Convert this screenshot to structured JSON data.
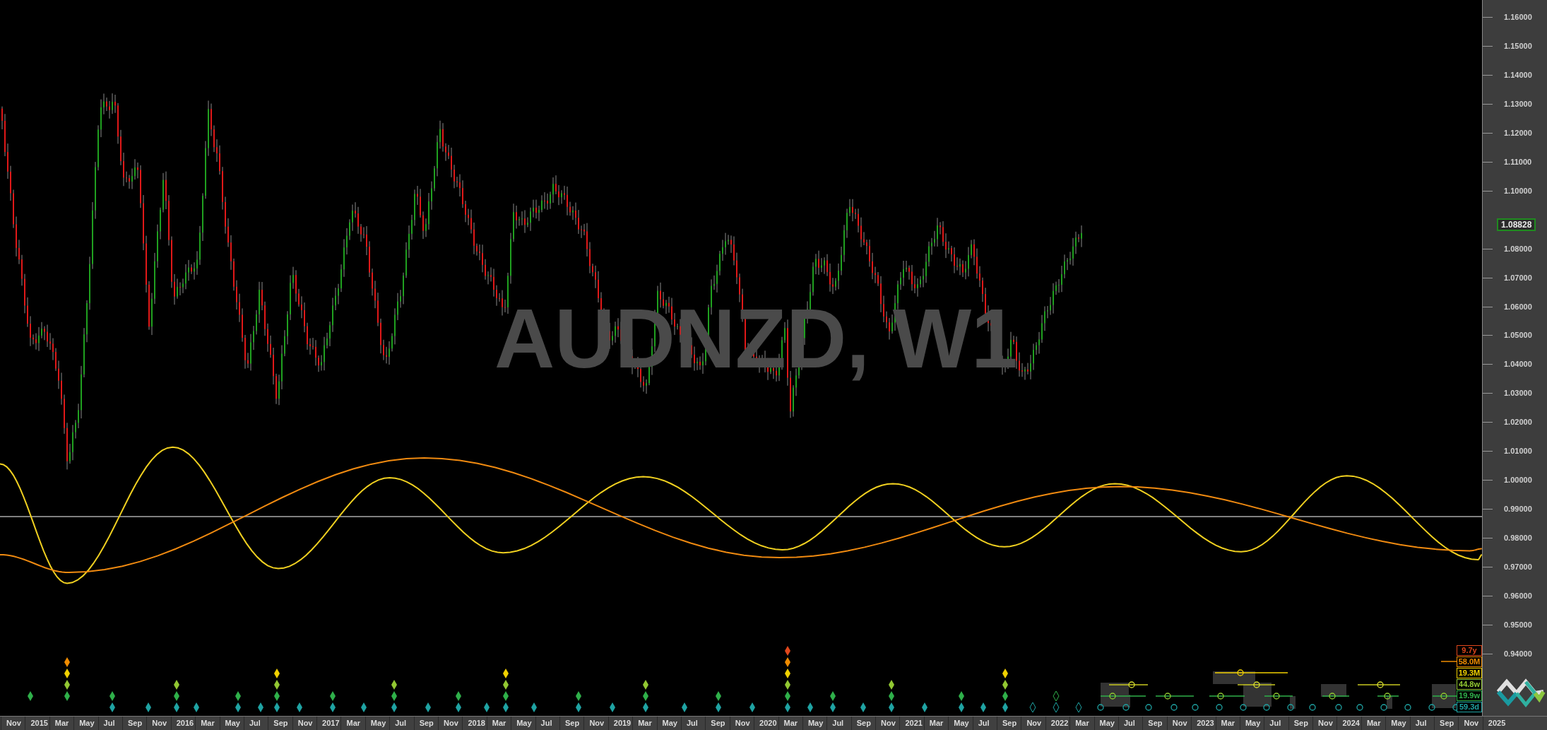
{
  "chart": {
    "symbol_label": "AUDNZD, W1"
  },
  "price_axis": {
    "ticks": [
      "1.16000",
      "1.15000",
      "1.14000",
      "1.13000",
      "1.12000",
      "1.11000",
      "1.10000",
      "1.08000",
      "1.07000",
      "1.06000",
      "1.05000",
      "1.04000",
      "1.03000",
      "1.02000",
      "1.01000",
      "1.00000",
      "0.99000",
      "0.98000",
      "0.97000",
      "0.96000",
      "0.95000",
      "0.94000"
    ],
    "current_price": "1.08828"
  },
  "time_axis": [
    "Nov",
    "2015",
    "Mar",
    "May",
    "Jul",
    "Sep",
    "Nov",
    "2016",
    "Mar",
    "May",
    "Jul",
    "Sep",
    "Nov",
    "2017",
    "Mar",
    "May",
    "Jul",
    "Sep",
    "Nov",
    "2018",
    "Mar",
    "May",
    "Jul",
    "Sep",
    "Nov",
    "2019",
    "Mar",
    "May",
    "Jul",
    "Sep",
    "Nov",
    "2020",
    "Mar",
    "May",
    "Jul",
    "Sep",
    "Nov",
    "2021",
    "Mar",
    "May",
    "Jul",
    "Sep",
    "Nov",
    "2022",
    "Mar",
    "May",
    "Jul",
    "Sep",
    "Nov",
    "2023",
    "Mar",
    "May",
    "Jul",
    "Sep",
    "Nov",
    "2024",
    "Mar",
    "May",
    "Jul",
    "Sep",
    "Nov",
    "2025"
  ],
  "cycle_legend": [
    {
      "label": "9.7y",
      "color": "#e0471c"
    },
    {
      "label": "58.0M",
      "color": "#f08c00"
    },
    {
      "label": "19.3M",
      "color": "#f0d000"
    },
    {
      "label": "44.8w",
      "color": "#92c832"
    },
    {
      "label": "19.9w",
      "color": "#2fb04a"
    },
    {
      "label": "59.3d",
      "color": "#1fa3a3"
    }
  ]
}
